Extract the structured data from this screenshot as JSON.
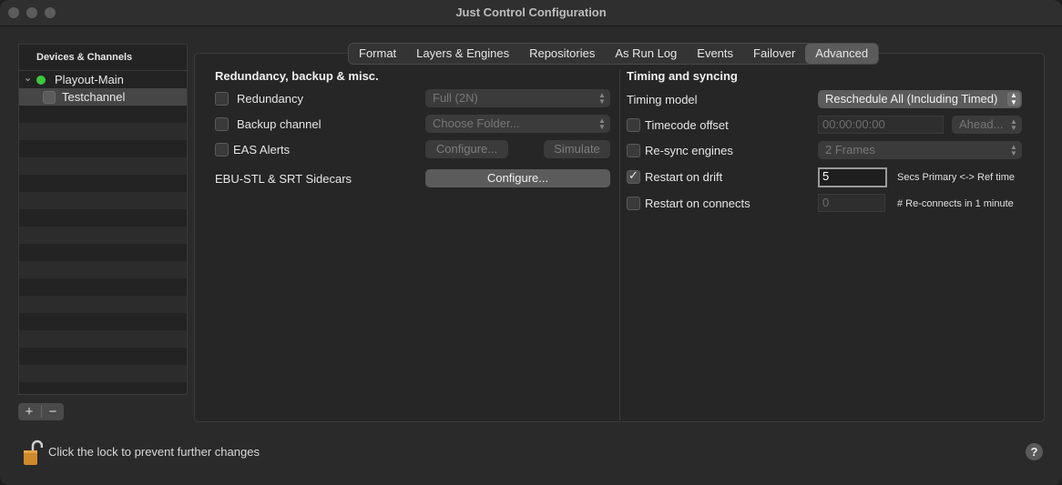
{
  "window": {
    "title": "Just Control Configuration"
  },
  "devices": {
    "header": "Devices & Channels",
    "items": [
      {
        "label": "Playout-Main"
      },
      {
        "label": "Testchannel"
      }
    ],
    "add_label": "+",
    "remove_label": "−"
  },
  "tabs": [
    "Format",
    "Layers & Engines",
    "Repositories",
    "As Run Log",
    "Events",
    "Failover",
    "Advanced"
  ],
  "active_tab": "Advanced",
  "left_section": {
    "heading": "Redundancy, backup & misc.",
    "redundancy": {
      "label": "Redundancy",
      "checked": false,
      "value": "Full (2N)"
    },
    "backup": {
      "label": "Backup channel",
      "checked": false,
      "value": "Choose Folder..."
    },
    "eas": {
      "label": "EAS Alerts",
      "checked": false,
      "configure": "Configure...",
      "simulate": "Simulate"
    },
    "ebu": {
      "label": "EBU-STL & SRT Sidecars",
      "configure": "Configure..."
    }
  },
  "right_section": {
    "heading": "Timing and syncing",
    "timing_model": {
      "label": "Timing model",
      "value": "Reschedule All (Including Timed)"
    },
    "timecode_offset": {
      "label": "Timecode offset",
      "checked": false,
      "value": "00:00:00:00",
      "direction": "Ahead..."
    },
    "resync": {
      "label": "Re-sync engines",
      "checked": false,
      "value": "2 Frames"
    },
    "restart_drift": {
      "label": "Restart on drift",
      "checked": true,
      "value": "5",
      "note": "Secs Primary <-> Ref time"
    },
    "restart_connects": {
      "label": "Restart on connects",
      "checked": false,
      "value": "0",
      "note": "# Re-connects in 1 minute"
    }
  },
  "footer": {
    "lock_text": "Click the lock to prevent further changes",
    "help": "?"
  }
}
